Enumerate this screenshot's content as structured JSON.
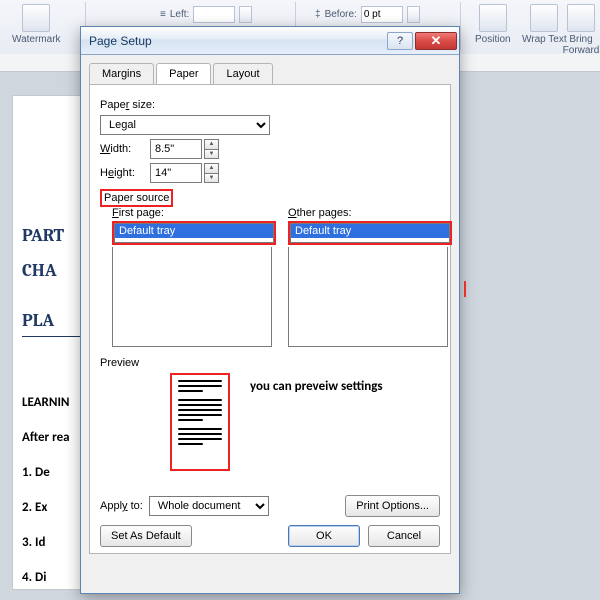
{
  "ribbon": {
    "watermark": "Watermark",
    "left_label": "Left:",
    "left_value": "",
    "before_label": "Before:",
    "before_value": "0 pt",
    "position": "Position",
    "wraptext": "Wrap Text",
    "bringfwd": "Bring Forward"
  },
  "dialog": {
    "title": "Page Setup",
    "tabs": {
      "margins": "Margins",
      "paper": "Paper",
      "layout": "Layout"
    },
    "paper_size_label": "Paper size:",
    "paper_size_value": "Legal",
    "width_label": "Width:",
    "width_value": "8.5\"",
    "height_label": "Height:",
    "height_value": "14\"",
    "paper_source_label": "Paper source",
    "first_page_label": "First page:",
    "first_page_value": "Default tray",
    "other_pages_label": "Other pages:",
    "other_pages_value": "Default tray",
    "preview_label": "Preview",
    "preview_note": "you can preveiw settings",
    "apply_to_label": "Apply to:",
    "apply_to_value": "Whole document",
    "print_options": "Print Options...",
    "set_default": "Set As Default",
    "ok": "OK",
    "cancel": "Cancel"
  },
  "doc": {
    "part": "PART",
    "cha": "CHA",
    "pla": "PLA",
    "learning": "LEARNIN",
    "after": "After rea",
    "li1": "1.      De",
    "li2": "2.      Ex",
    "li3": "3.      Id",
    "li4": "4.      Di"
  }
}
